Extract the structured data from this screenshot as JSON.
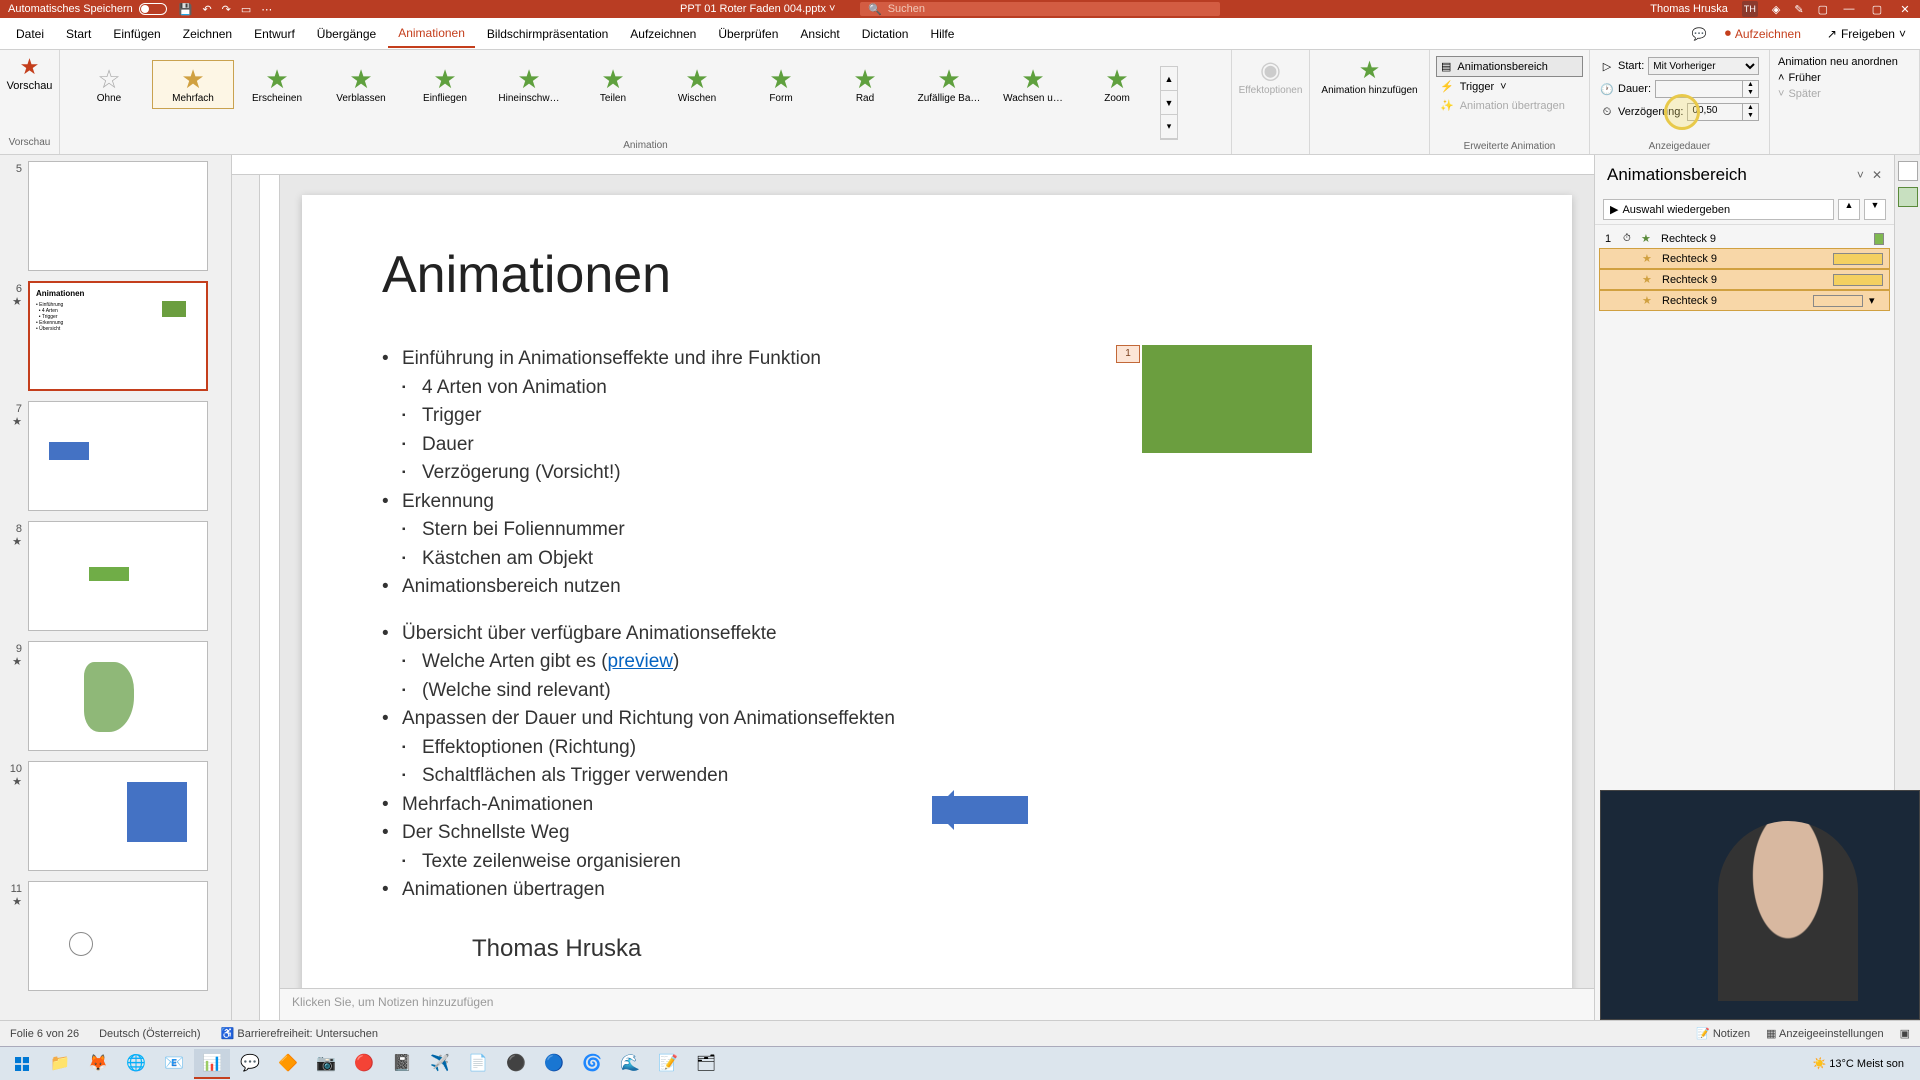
{
  "titlebar": {
    "autosave": "Automatisches Speichern",
    "filename": "PPT 01 Roter Faden 004.pptx",
    "search_placeholder": "Suchen",
    "user": "Thomas Hruska",
    "initials": "TH"
  },
  "menu": {
    "tabs": [
      "Datei",
      "Start",
      "Einfügen",
      "Zeichnen",
      "Entwurf",
      "Übergänge",
      "Animationen",
      "Bildschirmpräsentation",
      "Aufzeichnen",
      "Überprüfen",
      "Ansicht",
      "Dictation",
      "Hilfe"
    ],
    "active": "Animationen",
    "record": "Aufzeichnen",
    "share": "Freigeben"
  },
  "ribbon": {
    "preview": "Vorschau",
    "preview_group": "Vorschau",
    "animations": [
      "Ohne",
      "Mehrfach",
      "Erscheinen",
      "Verblassen",
      "Einfliegen",
      "Hineinschw…",
      "Teilen",
      "Wischen",
      "Form",
      "Rad",
      "Zufällige Ba…",
      "Wachsen u…",
      "Zoom"
    ],
    "anim_selected": "Mehrfach",
    "animation_group": "Animation",
    "effect_options": "Effektoptionen",
    "add_animation": "Animation hinzufügen",
    "adv_group": "Erweiterte Animation",
    "anim_pane": "Animationsbereich",
    "trigger": "Trigger",
    "transfer": "Animation übertragen",
    "start_label": "Start:",
    "start_value": "Mit Vorheriger",
    "duration_label": "Dauer:",
    "duration_value": "",
    "delay_label": "Verzögerung:",
    "delay_value": "00,50",
    "reorder_title": "Animation neu anordnen",
    "earlier": "Früher",
    "later": "Später",
    "timing_group": "Anzeigedauer"
  },
  "thumbs": [
    {
      "num": "5",
      "star": false
    },
    {
      "num": "6",
      "star": true,
      "selected": true,
      "title": "Animationen"
    },
    {
      "num": "7",
      "star": true
    },
    {
      "num": "8",
      "star": true
    },
    {
      "num": "9",
      "star": true
    },
    {
      "num": "10",
      "star": true
    },
    {
      "num": "11",
      "star": true
    }
  ],
  "slide": {
    "title": "Animationen",
    "bullets": [
      {
        "t": "Einführung in Animationseffekte und ihre Funktion",
        "sub": [
          "4 Arten von Animation",
          "Trigger",
          "Dauer",
          "Verzögerung (Vorsicht!)"
        ]
      },
      {
        "t": "Erkennung",
        "sub": [
          "Stern bei Foliennummer",
          "Kästchen am Objekt"
        ]
      },
      {
        "t": "Animationsbereich nutzen"
      },
      {
        "spacer": true
      },
      {
        "t": "Übersicht über verfügbare Animationseffekte",
        "sub": [
          "Welche Arten gibt es (preview)",
          "(Welche sind relevant)"
        ]
      },
      {
        "t": "Anpassen der Dauer und Richtung von Animationseffekten",
        "sub": [
          "Effektoptionen (Richtung)",
          "Schaltflächen als Trigger verwenden"
        ]
      },
      {
        "t": "Mehrfach-Animationen"
      },
      {
        "t": "Der Schnellste Weg",
        "sub": [
          "Texte zeilenweise organisieren"
        ]
      },
      {
        "t": "Animationen übertragen"
      }
    ],
    "author": "Thomas Hruska",
    "anim_tag": "1"
  },
  "notes_placeholder": "Klicken Sie, um Notizen hinzuzufügen",
  "anim_pane": {
    "title": "Animationsbereich",
    "play": "Auswahl wiedergeben",
    "items": [
      {
        "num": "1",
        "trig": "⏱",
        "eff": "★",
        "name": "Rechteck 9",
        "bar": "g",
        "sel": false
      },
      {
        "num": "",
        "trig": "",
        "eff": "★",
        "name": "Rechteck 9",
        "bar": "y",
        "sel": true
      },
      {
        "num": "",
        "trig": "",
        "eff": "★",
        "name": "Rechteck 9",
        "bar": "y",
        "sel": true
      },
      {
        "num": "",
        "trig": "",
        "eff": "★",
        "name": "Rechteck 9",
        "bar": "",
        "sel": true,
        "menu": true
      }
    ]
  },
  "status": {
    "slide": "Folie 6 von 26",
    "lang": "Deutsch (Österreich)",
    "access": "Barrierefreiheit: Untersuchen",
    "notes": "Notizen",
    "display": "Anzeigeeinstellungen"
  },
  "taskbar": {
    "weather": "13°C  Meist son"
  }
}
